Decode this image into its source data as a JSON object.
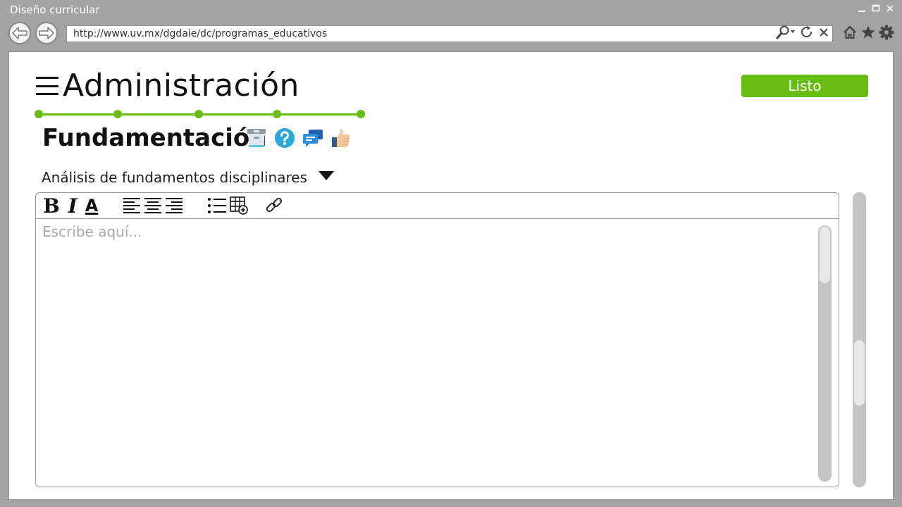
{
  "window": {
    "title": "Diseño curricular",
    "controls": [
      "minimize",
      "maximize",
      "close"
    ]
  },
  "browser": {
    "url": "http://www.uv.mx/dgdaie/dc/programas_educativos",
    "icons": [
      "back-icon",
      "forward-icon",
      "search-icon",
      "refresh-icon",
      "close-icon",
      "home-icon",
      "star-icon",
      "gear-icon"
    ]
  },
  "header": {
    "title": "Administración",
    "done_label": "Listo"
  },
  "stepper": {
    "steps": 5,
    "color": "#67bd10"
  },
  "section": {
    "title": "Fundamentación",
    "icons": [
      "archive-icon",
      "help-icon",
      "comments-icon",
      "thumbs-up-icon"
    ]
  },
  "dropdown": {
    "selected": "Análisis de fundamentos  disciplinares"
  },
  "editor": {
    "placeholder": "Escribe aquí...",
    "toolbar": {
      "bold": "B",
      "italic": "I",
      "color": "A"
    }
  },
  "colors": {
    "accent": "#67bd10",
    "chrome": "#a3a3a3"
  }
}
